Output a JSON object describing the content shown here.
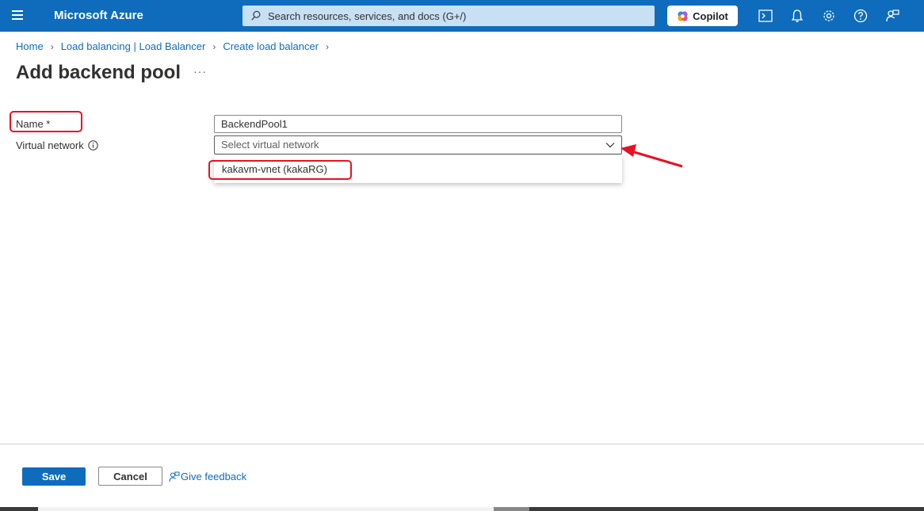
{
  "topbar": {
    "brand": "Microsoft Azure",
    "search_placeholder": "Search resources, services, and docs (G+/)",
    "copilot_label": "Copilot",
    "icons": [
      "cloud-shell-icon",
      "bell-icon",
      "gear-icon",
      "help-icon",
      "feedback-icon"
    ]
  },
  "breadcrumb": {
    "items": [
      "Home",
      "Load balancing | Load Balancer",
      "Create load balancer"
    ]
  },
  "page": {
    "title": "Add backend pool",
    "more": "···"
  },
  "form": {
    "name_label": "Name *",
    "name_value": "BackendPool1",
    "vnet_label": "Virtual network",
    "vnet_placeholder": "Select virtual network",
    "vnet_options": [
      "kakavm-vnet (kakaRG)"
    ]
  },
  "footer": {
    "save_label": "Save",
    "cancel_label": "Cancel",
    "feedback_label": "Give feedback"
  },
  "colors": {
    "accent": "#0f6cbd",
    "highlight": "#e81123"
  }
}
